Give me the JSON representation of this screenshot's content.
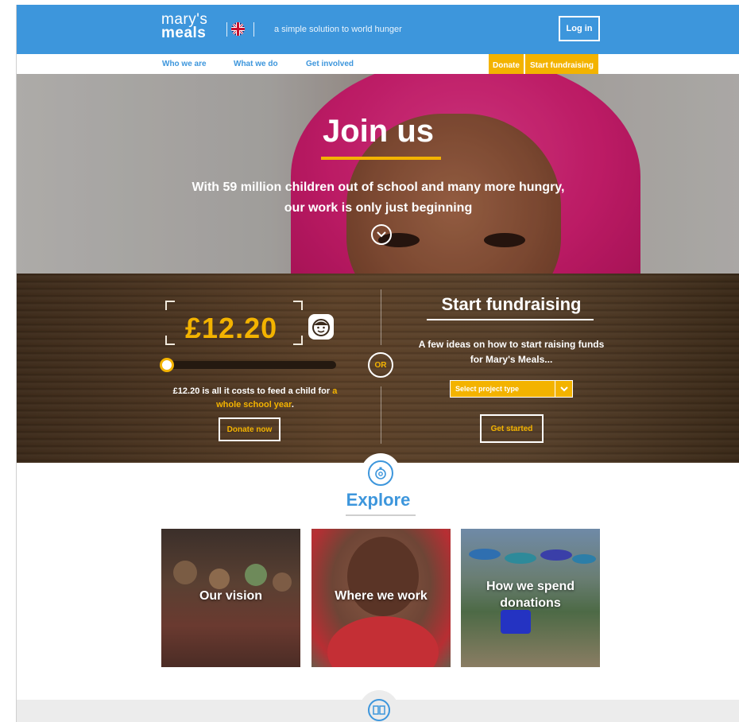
{
  "header": {
    "logo_line1": "mary's",
    "logo_line2": "meals",
    "tagline": "a simple solution to world hunger",
    "login_label": "Log in",
    "language_icon": "uk-flag-icon"
  },
  "nav": {
    "items": [
      "Who we are",
      "What we do",
      "Get involved"
    ],
    "donate_label": "Donate",
    "fundraise_label": "Start fundraising"
  },
  "hero": {
    "title": "Join us",
    "subtitle": "With 59 million children out of school and many more hungry, our work is only just beginning",
    "scroll_icon": "chevron-down-icon"
  },
  "donate_panel": {
    "amount": "£12.20",
    "slider_fraction": 0.0,
    "cost_prefix": "£12.20 is all it costs to feed a child for ",
    "cost_highlight": "a whole school year",
    "cost_suffix": ".",
    "donate_now_label": "Donate now"
  },
  "or_label": "OR",
  "fundraise_panel": {
    "title": "Start fundraising",
    "subtitle": "A few ideas on how to start raising funds for Mary's Meals...",
    "select_placeholder": "Select project type",
    "get_started_label": "Get started"
  },
  "explore": {
    "title": "Explore",
    "cards": [
      {
        "label": "Our vision"
      },
      {
        "label": "Where we work"
      },
      {
        "label": "How we spend donations"
      }
    ]
  },
  "colors": {
    "brand_blue": "#3d96dc",
    "accent_yellow": "#f3b300"
  }
}
